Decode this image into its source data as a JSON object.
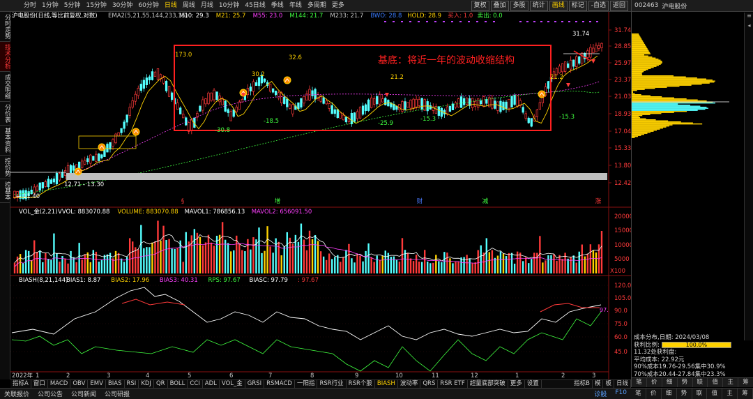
{
  "toolbar": {
    "periods": [
      "分时",
      "1分钟",
      "5分钟",
      "15分钟",
      "30分钟",
      "60分钟",
      "日线",
      "周线",
      "月线",
      "10分钟",
      "45日线",
      "季线",
      "年线",
      "多周期",
      "更多"
    ],
    "active_period": "日线",
    "right_buttons": [
      "复权",
      "叠加",
      "多股",
      "统计",
      "画线",
      "标记",
      "-自选",
      "返回"
    ],
    "active_button": "画线"
  },
  "left_tabs": [
    "分时走势",
    "技术分析",
    "成交明细",
    "分价表",
    "基本资料",
    "控价势",
    "控基本"
  ],
  "active_left_tab": "技术分析",
  "main_legend": {
    "stock": "沪电股份(日线,等比前复权,对数)",
    "ema_label": "EMA2(5,21,55,144,233,15)",
    "items": [
      {
        "label": "M10: 29.3",
        "color": "#ffffff"
      },
      {
        "label": "M21: 25.7",
        "color": "#ffd200"
      },
      {
        "label": "M55: 23.0",
        "color": "#ff40ff"
      },
      {
        "label": "M144: 21.7",
        "color": "#40ff40"
      },
      {
        "label": "M233: 21.7",
        "color": "#c8c8c8"
      },
      {
        "label": "BWO: 28.8",
        "color": "#3a7bff"
      },
      {
        "label": "HOLD: 28.9",
        "color": "#ffd200"
      },
      {
        "label": "买入: 1.0",
        "color": "#ff3a3a"
      },
      {
        "label": "卖出: 0.0",
        "color": "#40ff40"
      }
    ]
  },
  "annotation": {
    "text": "基底：将近一年的波动收缩结构",
    "color": "#ff2020"
  },
  "price_labels": [
    {
      "text": "173.0",
      "color": "#ffd200"
    },
    {
      "text": "30.2",
      "color": "#ffd200"
    },
    {
      "text": "32.6",
      "color": "#ffd200"
    },
    {
      "text": "21.2",
      "color": "#ffd200"
    },
    {
      "text": "21.2",
      "color": "#ffd200"
    },
    {
      "text": "31.74",
      "color": "#ffffff"
    },
    {
      "text": "-30.8",
      "color": "#40ff40"
    },
    {
      "text": "-18.5",
      "color": "#40ff40"
    },
    {
      "text": "-25.9",
      "color": "#40ff40"
    },
    {
      "text": "-15.3",
      "color": "#40ff40"
    },
    {
      "text": "-15.3",
      "color": "#40ff40"
    },
    {
      "text": "12.71 - 13.30",
      "color": "#ffffff"
    },
    {
      "text": "← 11.40",
      "color": "#ffffff"
    }
  ],
  "price_axis": [
    "31.74",
    "28.85",
    "25.97",
    "23.37",
    "21.03",
    "18.93",
    "17.04",
    "15.33",
    "13.80",
    "12.42"
  ],
  "event_markers": [
    {
      "text": "§",
      "color": "#ff3a3a"
    },
    {
      "text": "增",
      "color": "#40ff40"
    },
    {
      "text": "财",
      "color": "#4a7bff"
    },
    {
      "text": "减",
      "color": "#40ff40"
    },
    {
      "text": "涨",
      "color": "#ff3a3a"
    }
  ],
  "vol_legend": {
    "name": "VOL_金(2,21)",
    "items": [
      {
        "label": "VVOL: 883070.88",
        "color": "#ffffff"
      },
      {
        "label": "VOLUME: 883070.88",
        "color": "#ffd200"
      },
      {
        "label": "MAVOL1: 786856.13",
        "color": "#ffffff"
      },
      {
        "label": "MAVOL2: 656091.50",
        "color": "#ff40ff"
      }
    ]
  },
  "vol_axis": [
    "20000",
    "15000",
    "10000",
    "5000",
    "X100"
  ],
  "bias_legend": {
    "name": "BIASH(8,21,144)",
    "items": [
      {
        "label": "BIAS1: 8.87",
        "color": "#ffffff"
      },
      {
        "label": "BIAS2: 17.96",
        "color": "#ffd200"
      },
      {
        "label": "BIAS3: 40.31",
        "color": "#ff40ff"
      },
      {
        "label": "RPS: 97.67",
        "color": "#40ff40"
      },
      {
        "label": "BIASC: 97.79",
        "color": "#ffffff"
      },
      {
        "label": ": 97.67",
        "color": "#ff3a3a"
      }
    ]
  },
  "bias_axis": [
    "120.0",
    "105.0",
    "90.0",
    "75.0",
    "60.0",
    "45.0"
  ],
  "bias_current": "97.",
  "time_axis": [
    "2022年",
    "1",
    "2",
    "3",
    "4",
    "5",
    "6",
    "7",
    "8",
    "9",
    "10",
    "11",
    "12",
    "1",
    "2",
    "3"
  ],
  "indicator_tabs": [
    "指标A",
    "窗口",
    "MACD",
    "OBV",
    "EMV",
    "BIAS",
    "RSI",
    "KDJ",
    "QR",
    "BOLL",
    "CCI",
    "ADL",
    "VOL_金",
    "GRSI",
    "RSMACD",
    "一阳指",
    "RSR行业",
    "RSR个股",
    "BIASH",
    "波动率",
    "QRS",
    "RSR ETF",
    "超量底部突破",
    "更多",
    "设置"
  ],
  "active_indicator": "BIASH",
  "indicator_right": [
    "指标B",
    "模",
    "板",
    "日线"
  ],
  "status_bar": {
    "left": [
      "关联报价",
      "公司公告",
      "公司新闻",
      "公司研报"
    ],
    "right": [
      "诊股",
      "F10"
    ]
  },
  "right_panel": {
    "code": "002463",
    "name": "沪电股份",
    "stats": {
      "dist_label": "成本分布,日期: 2024/03/08",
      "profit_label": "获利比例:",
      "profit_value": "100.0%",
      "profit_fraction": 1.0,
      "line3": "11.32处获利盘:",
      "line4": "平均成本: 22.92元",
      "line5": "90%成本19.76-29.56集中30.9%",
      "line6": "70%成本20.44-27.84集中23.3%"
    },
    "bottom_tabs": [
      "笔",
      "价",
      "细",
      "势",
      "联",
      "值",
      "主",
      "筹"
    ],
    "foot_tabs": [
      "笔",
      "价",
      "细",
      "势",
      "联",
      "值",
      "主",
      "筹"
    ]
  }
}
